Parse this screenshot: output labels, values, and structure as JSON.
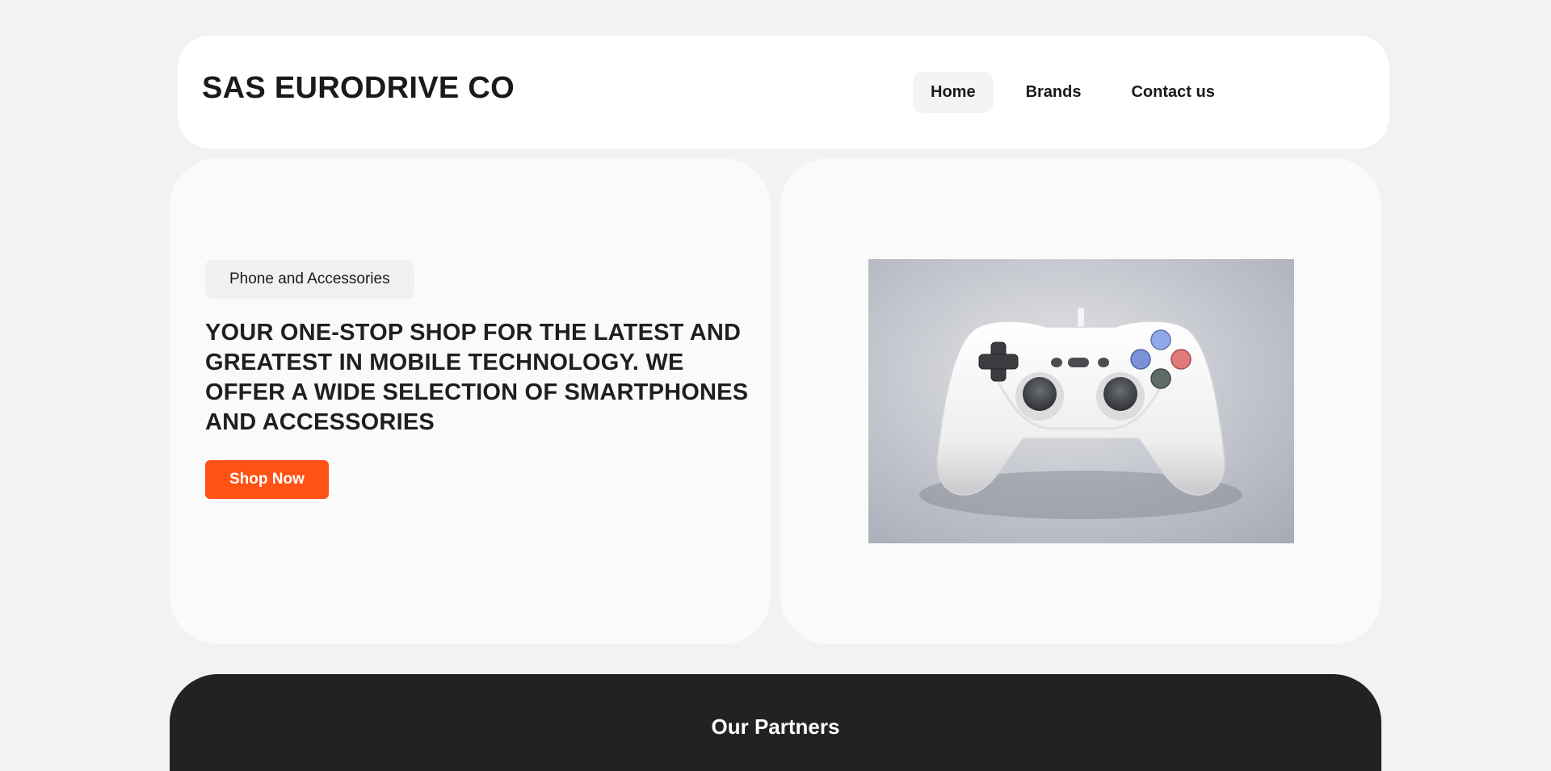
{
  "header": {
    "brand": "SAS EURODRIVE CO",
    "nav": [
      {
        "label": "Home",
        "active": true
      },
      {
        "label": "Brands",
        "active": false
      },
      {
        "label": "Contact us",
        "active": false
      }
    ]
  },
  "hero": {
    "tag": "Phone and Accessories",
    "headline": "YOUR ONE-STOP SHOP FOR THE LATEST AND GREATEST IN MOBILE TECHNOLOGY. WE OFFER A WIDE SELECTION OF SMARTPHONES AND ACCESSORIES",
    "cta_label": "Shop Now",
    "image_subject": "white game controller"
  },
  "partners": {
    "title": "Our Partners"
  },
  "colors": {
    "accent": "#ff5215",
    "page_background": "#f2f2f2",
    "card_background": "#fafafa",
    "footer_background": "#222222"
  },
  "icons": [
    "game-controller-image"
  ]
}
